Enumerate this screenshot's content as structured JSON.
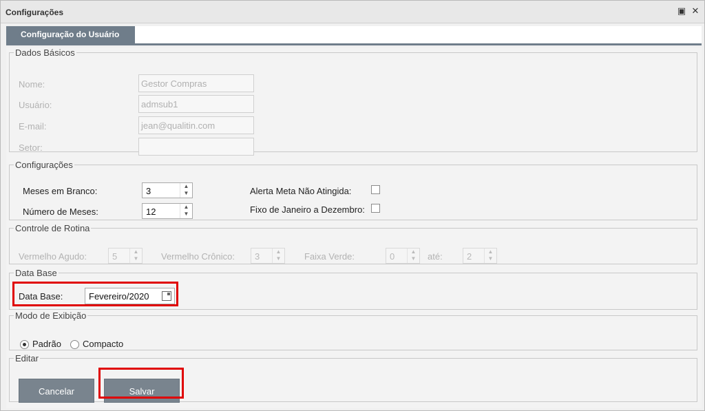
{
  "window": {
    "title": "Configurações"
  },
  "tabs": [
    {
      "label": "Configuração do Usuário"
    }
  ],
  "dados_basicos": {
    "legend": "Dados Básicos",
    "fields": [
      {
        "label": "Nome:",
        "value": "Gestor Compras"
      },
      {
        "label": "Usuário:",
        "value": "admsub1"
      },
      {
        "label": "E-mail:",
        "value": "jean@qualitin.com"
      },
      {
        "label": "Setor:",
        "value": ""
      }
    ]
  },
  "configuracoes": {
    "legend": "Configurações",
    "meses_branco": {
      "label": "Meses em Branco:",
      "value": "3"
    },
    "numero_meses": {
      "label": "Número de Meses:",
      "value": "12"
    },
    "alerta_meta": {
      "label": "Alerta Meta Não Atingida:",
      "checked": false
    },
    "fixo_janeiro": {
      "label": "Fixo de Janeiro a Dezembro:",
      "checked": false
    }
  },
  "controle_rotina": {
    "legend": "Controle de Rotina",
    "vermelho_agudo": {
      "label": "Vermelho Agudo:",
      "value": "5"
    },
    "vermelho_cronico": {
      "label": "Vermelho Crônico:",
      "value": "3"
    },
    "faixa_verde": {
      "label": "Faixa Verde:",
      "value": "0"
    },
    "ate": {
      "label": "até:",
      "value": "2"
    }
  },
  "data_base": {
    "legend": "Data Base",
    "label": "Data Base:",
    "value": "Fevereiro/2020"
  },
  "modo_exibicao": {
    "legend": "Modo de Exibição",
    "options": [
      {
        "label": "Padrão",
        "selected": true
      },
      {
        "label": "Compacto",
        "selected": false
      }
    ]
  },
  "editar": {
    "legend": "Editar",
    "cancel_label": "Cancelar",
    "save_label": "Salvar"
  },
  "colors": {
    "tab_active": "#6f7d8a",
    "button": "#79848e",
    "highlight": "#e00000"
  }
}
